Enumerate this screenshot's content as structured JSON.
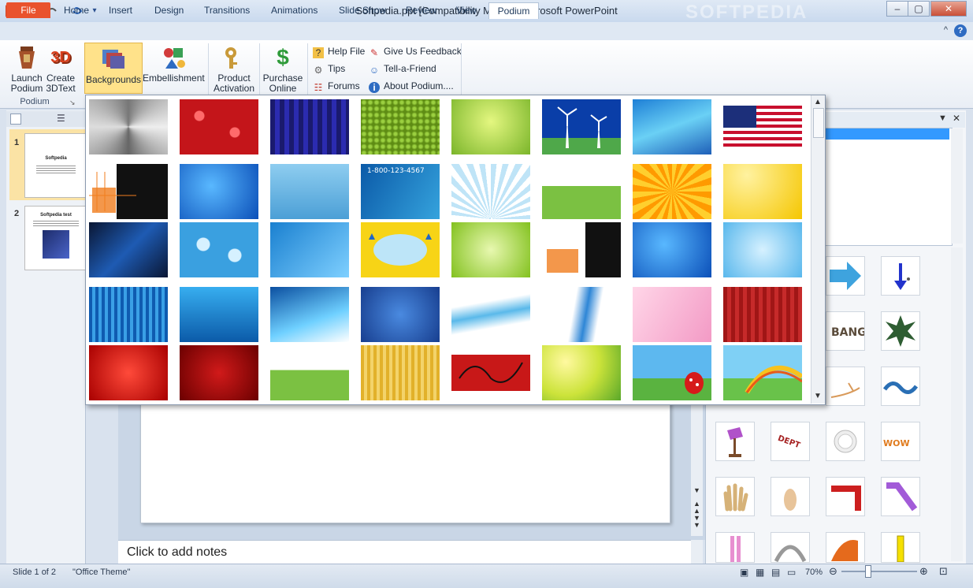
{
  "window": {
    "title": "Softpedia.ppt [Compatibility Mode]  -  Microsoft PowerPoint",
    "app_icon": "P",
    "watermark": "SOFTPEDIA"
  },
  "quick_access": {
    "save_icon": "save-icon",
    "undo_icon": "undo-icon",
    "redo_icon": "redo-icon"
  },
  "window_buttons": {
    "minimize": "–",
    "maximize": "▢",
    "close": "✕"
  },
  "tabs": [
    "File",
    "Home",
    "Insert",
    "Design",
    "Transitions",
    "Animations",
    "Slide Show",
    "Review",
    "View",
    "Podium"
  ],
  "active_tab": "Podium",
  "ribbon": {
    "buttons": [
      {
        "label": "Launch\nPodium"
      },
      {
        "label": "Create\n3DText",
        "icon_text": "3D"
      },
      {
        "label": "Backgrounds"
      },
      {
        "label": "Embellishment"
      },
      {
        "label": "Product\nActivation"
      },
      {
        "label": "Purchase\nOnline",
        "icon_text": "$"
      }
    ],
    "small_buttons": [
      {
        "label": "Help File",
        "icon_text": "?"
      },
      {
        "label": "Give Us Feedback",
        "icon_text": "✎"
      },
      {
        "label": "Tips",
        "icon_text": "⚙"
      },
      {
        "label": "Tell-a-Friend",
        "icon_text": "☺"
      },
      {
        "label": "Forums",
        "icon_text": "☷"
      },
      {
        "label": "About Podium....",
        "icon_text": "i"
      }
    ],
    "group_label": "Podium",
    "help_symbol": "?",
    "minimize_symbol": "^"
  },
  "slides": [
    {
      "number": "1",
      "title": "Softpedia"
    },
    {
      "number": "2",
      "title": "Softpedia test"
    }
  ],
  "notes_placeholder": "Click to add notes",
  "status": {
    "slide": "Slide 1 of 2",
    "theme": "\"Office Theme\"",
    "zoom": "70%"
  },
  "colors": {
    "accent": "#e9522d",
    "selection": "#3399ff",
    "ribbon_highlight": "#ffe28a"
  }
}
